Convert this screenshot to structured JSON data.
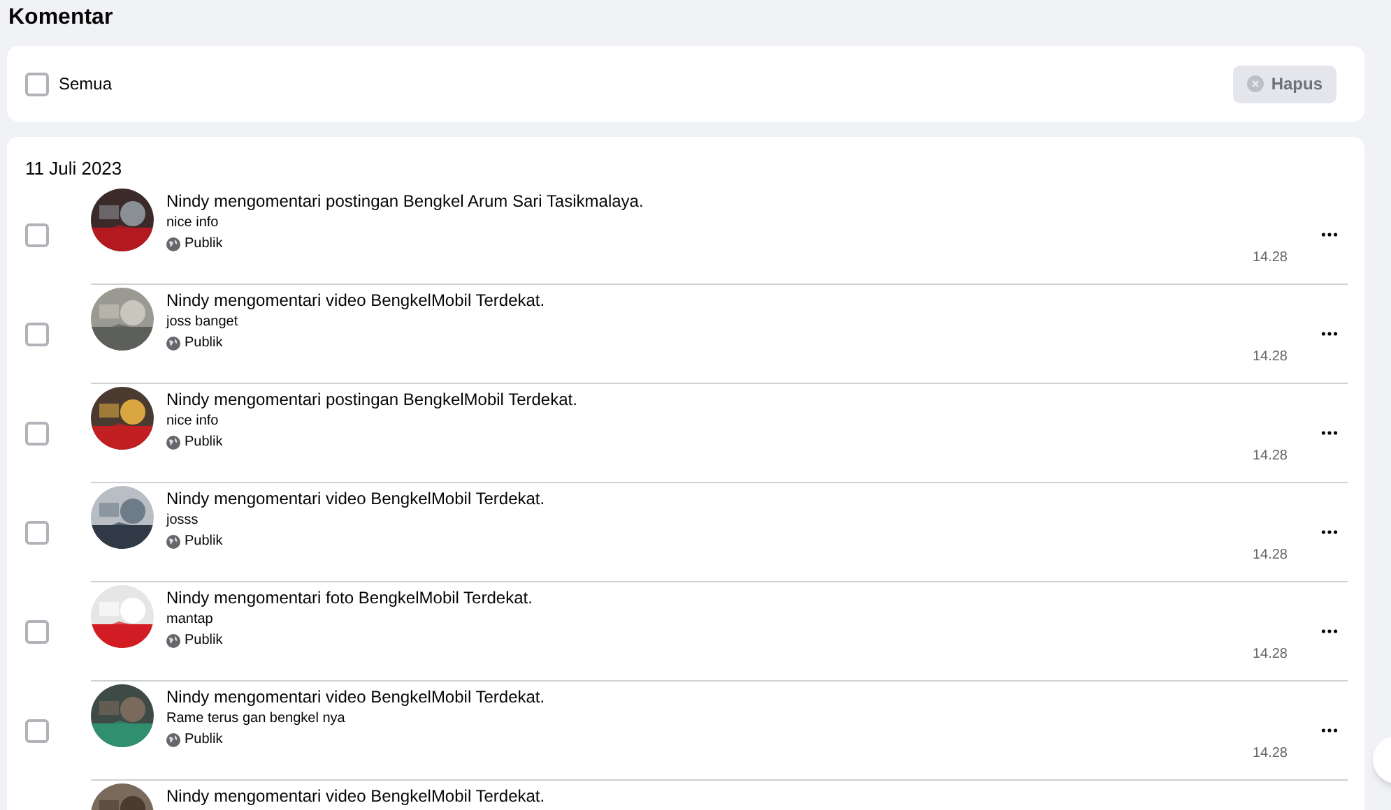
{
  "title": "Komentar",
  "toolbar": {
    "select_all": {
      "label": "Semua",
      "checked": false
    },
    "delete_button": {
      "label": "Hapus",
      "disabled": true
    }
  },
  "groups": [
    {
      "date": "11 Juli 2023",
      "items": [
        {
          "action": "Nindy mengomentari postingan Bengkel Arum Sari Tasikmalaya.",
          "comment": "nice info",
          "privacy": "Publik",
          "time": "14.28",
          "checked": false
        },
        {
          "action": "Nindy mengomentari video BengkelMobil Terdekat.",
          "comment": "joss banget",
          "privacy": "Publik",
          "time": "14.28",
          "checked": false
        },
        {
          "action": "Nindy mengomentari postingan BengkelMobil Terdekat.",
          "comment": "nice info",
          "privacy": "Publik",
          "time": "14.28",
          "checked": false
        },
        {
          "action": "Nindy mengomentari video BengkelMobil Terdekat.",
          "comment": "josss",
          "privacy": "Publik",
          "time": "14.28",
          "checked": false
        },
        {
          "action": "Nindy mengomentari foto BengkelMobil Terdekat.",
          "comment": "mantap",
          "privacy": "Publik",
          "time": "14.28",
          "checked": false
        },
        {
          "action": "Nindy mengomentari video BengkelMobil Terdekat.",
          "comment": "Rame terus gan bengkel nya",
          "privacy": "Publik",
          "time": "14.28",
          "checked": false
        },
        {
          "action": "Nindy mengomentari video BengkelMobil Terdekat."
        }
      ]
    }
  ]
}
